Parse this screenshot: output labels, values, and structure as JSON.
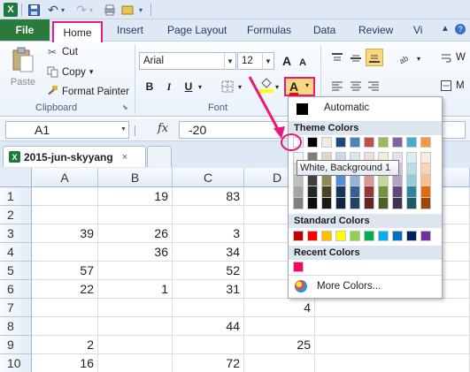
{
  "qat": {
    "logo": "X",
    "undo_icon": "↶",
    "redo_icon": "↷",
    "save_icon": "💾",
    "more_icon": "▾"
  },
  "tabs": {
    "file": "File",
    "home": "Home",
    "insert": "Insert",
    "page_layout": "Page Layout",
    "formulas": "Formulas",
    "data": "Data",
    "review": "Review",
    "view": "Vi"
  },
  "ribbon": {
    "clipboard": {
      "paste": "Paste",
      "cut": "Cut",
      "copy": "Copy",
      "copy_arrow": "▾",
      "format_painter": "Format Painter",
      "group_label": "Clipboard"
    },
    "font": {
      "name": "Arial",
      "size": "12",
      "bold": "B",
      "italic": "I",
      "underline": "U",
      "group_label": "Font",
      "font_color_letter": "A",
      "grow": "A",
      "shrink": "A"
    },
    "alignment": {
      "wrap": "W",
      "merge": "M"
    }
  },
  "formula_bar": {
    "name_box": "A1",
    "fx": "fx",
    "value": "-20"
  },
  "workbook": {
    "tab_label": "2015-jun-skyyang",
    "close": "×",
    "icon": "X"
  },
  "grid": {
    "columns": [
      "A",
      "B",
      "C",
      "D"
    ],
    "rows": [
      {
        "n": "1",
        "cells": [
          "",
          "19",
          "83",
          ""
        ]
      },
      {
        "n": "2",
        "cells": [
          "",
          "",
          "",
          ""
        ]
      },
      {
        "n": "3",
        "cells": [
          "39",
          "26",
          "3",
          ""
        ]
      },
      {
        "n": "4",
        "cells": [
          "",
          "36",
          "34",
          ""
        ]
      },
      {
        "n": "5",
        "cells": [
          "57",
          "",
          "52",
          ""
        ]
      },
      {
        "n": "6",
        "cells": [
          "22",
          "1",
          "31",
          ""
        ]
      },
      {
        "n": "7",
        "cells": [
          "",
          "",
          "",
          "4"
        ]
      },
      {
        "n": "8",
        "cells": [
          "",
          "",
          "44",
          ""
        ]
      },
      {
        "n": "9",
        "cells": [
          "2",
          "",
          "",
          "25"
        ]
      },
      {
        "n": "10",
        "cells": [
          "16",
          "",
          "72",
          ""
        ]
      }
    ]
  },
  "color_menu": {
    "automatic": "Automatic",
    "theme_colors": "Theme Colors",
    "standard_colors": "Standard Colors",
    "recent_colors": "Recent Colors",
    "more_colors": "More Colors...",
    "tooltip": "White, Background 1",
    "theme_top": [
      "#ffffff",
      "#000000",
      "#eeece1",
      "#1f497d",
      "#4f81bd",
      "#c0504d",
      "#9bbb59",
      "#8064a2",
      "#4bacc6",
      "#f79646"
    ],
    "theme_shades": [
      [
        "#f2f2f2",
        "#7f7f7f",
        "#ddd9c3",
        "#c6d9f0",
        "#dbe5f1",
        "#f2dcdb",
        "#ebf1dd",
        "#e5e0ec",
        "#dbeef3",
        "#fdeada"
      ],
      [
        "#d8d8d8",
        "#595959",
        "#c4bd97",
        "#8db3e2",
        "#b8cce4",
        "#e5b9b7",
        "#d7e3bc",
        "#ccc1d9",
        "#b7dde8",
        "#fbd5b5"
      ],
      [
        "#bfbfbf",
        "#3f3f3f",
        "#938953",
        "#548dd4",
        "#95b3d7",
        "#d99694",
        "#c3d69b",
        "#b2a2c7",
        "#92cddc",
        "#fac08f"
      ],
      [
        "#a5a5a5",
        "#262626",
        "#494429",
        "#17365d",
        "#366092",
        "#953734",
        "#76923c",
        "#5f497a",
        "#31859b",
        "#e36c09"
      ],
      [
        "#7f7f7f",
        "#0c0c0c",
        "#1d1b10",
        "#0f243e",
        "#244061",
        "#632423",
        "#4f6128",
        "#3f3151",
        "#205867",
        "#974806"
      ]
    ],
    "standard": [
      "#c00000",
      "#ff0000",
      "#ffc000",
      "#ffff00",
      "#92d050",
      "#00b050",
      "#00b0f0",
      "#0070c0",
      "#002060",
      "#7030a0"
    ],
    "recent": [
      "#ff0066"
    ]
  }
}
